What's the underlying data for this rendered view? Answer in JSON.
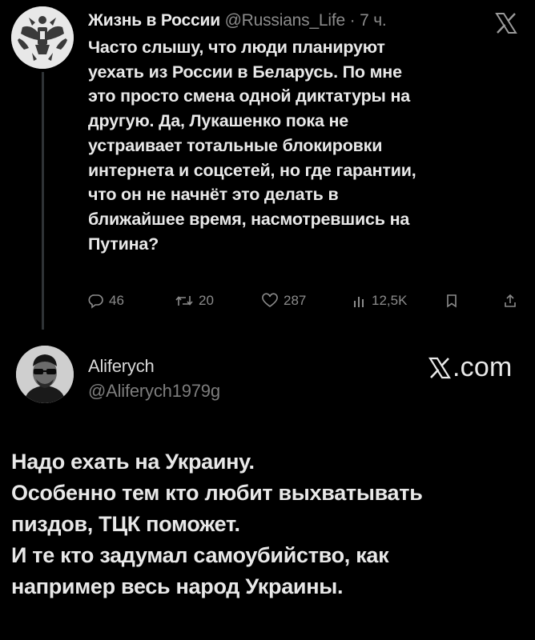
{
  "tweet": {
    "author_name": "Жизнь в России",
    "author_handle": "@Russians_Life",
    "separator": "·",
    "time": "7 ч.",
    "text_lines": [
      "Часто слышу, что люди планируют",
      "уехать из России в Беларусь. По мне",
      "это просто смена одной диктатуры на",
      "другую. Да, Лукашенко пока не",
      "устраивает тотальные блокировки",
      "интернета и соцсетей, но где гарантии,",
      "что он не начнёт это делать в",
      "ближайшее время, насмотревшись на",
      "Путина?"
    ],
    "actions": {
      "replies": "46",
      "retweets": "20",
      "likes": "287",
      "views": "12,5K"
    },
    "icons": {
      "avatar": "double-headed-eagle-emblem-icon",
      "platform": "x-logo-icon",
      "reply": "reply-icon",
      "retweet": "retweet-icon",
      "like": "heart-icon",
      "views": "views-bar-chart-icon",
      "bookmark": "bookmark-icon",
      "share": "share-icon"
    }
  },
  "reply": {
    "author_name": "Aliferych",
    "author_handle": "@Aliferych1979g",
    "watermark": ".com",
    "text_lines": [
      "Надо ехать на Украину.",
      "Особенно тем кто любит выхватывать",
      "пиздов, ТЦК поможет.",
      "И те кто задумал самоубийство, как",
      "например весь народ Украины."
    ]
  },
  "colors": {
    "background": "#000000",
    "text": "#e8e8e8",
    "muted": "#8b8b8b",
    "thread_line": "#2f3336"
  }
}
